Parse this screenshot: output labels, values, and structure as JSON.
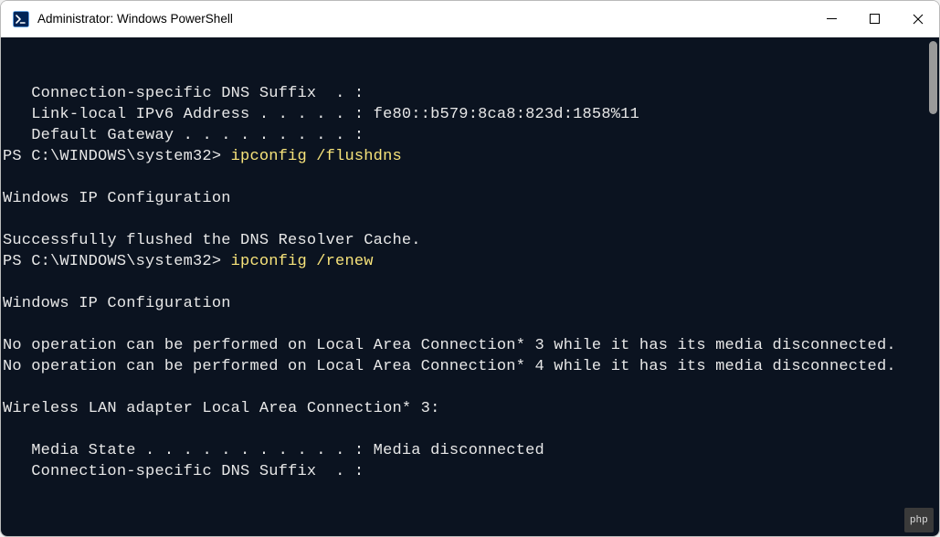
{
  "titlebar": {
    "title": "Administrator: Windows PowerShell"
  },
  "terminal": {
    "lines": [
      {
        "type": "plain",
        "text": "   Connection-specific DNS Suffix  . :"
      },
      {
        "type": "plain",
        "text": "   Link-local IPv6 Address . . . . . : fe80::b579:8ca8:823d:1858%11"
      },
      {
        "type": "plain",
        "text": "   Default Gateway . . . . . . . . . :"
      },
      {
        "type": "prompt",
        "prompt": "PS C:\\WINDOWS\\system32> ",
        "command": "ipconfig /flushdns"
      },
      {
        "type": "blank"
      },
      {
        "type": "plain",
        "text": "Windows IP Configuration"
      },
      {
        "type": "blank"
      },
      {
        "type": "plain",
        "text": "Successfully flushed the DNS Resolver Cache."
      },
      {
        "type": "prompt",
        "prompt": "PS C:\\WINDOWS\\system32> ",
        "command": "ipconfig /renew"
      },
      {
        "type": "blank"
      },
      {
        "type": "plain",
        "text": "Windows IP Configuration"
      },
      {
        "type": "blank"
      },
      {
        "type": "plain",
        "text": "No operation can be performed on Local Area Connection* 3 while it has its media disconnected."
      },
      {
        "type": "plain",
        "text": "No operation can be performed on Local Area Connection* 4 while it has its media disconnected."
      },
      {
        "type": "blank"
      },
      {
        "type": "plain",
        "text": "Wireless LAN adapter Local Area Connection* 3:"
      },
      {
        "type": "blank"
      },
      {
        "type": "plain",
        "text": "   Media State . . . . . . . . . . . : Media disconnected"
      },
      {
        "type": "plain",
        "text": "   Connection-specific DNS Suffix  . :"
      }
    ]
  },
  "watermark": {
    "text": "php"
  }
}
